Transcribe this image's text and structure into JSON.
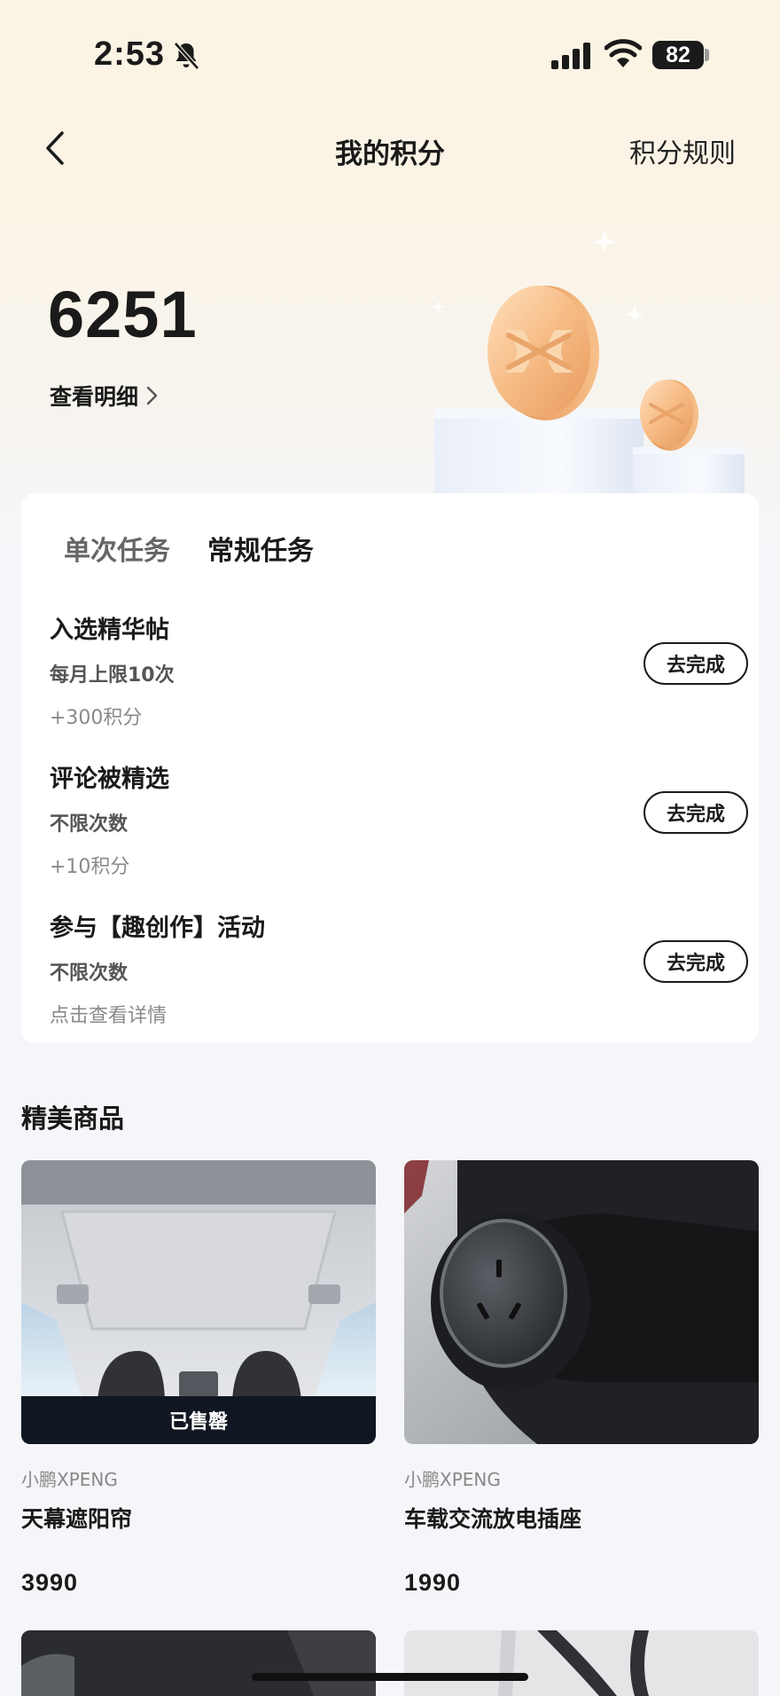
{
  "status_bar": {
    "time": "2:53",
    "battery": "82"
  },
  "nav": {
    "title": "我的积分",
    "rules_label": "积分规则"
  },
  "points": {
    "value": "6251",
    "detail_label": "查看明细"
  },
  "tasks": {
    "tabs": [
      {
        "label": "单次任务",
        "active": false
      },
      {
        "label": "常规任务",
        "active": true
      }
    ],
    "items": [
      {
        "title": "入选精华帖",
        "limit": "每月上限10次",
        "reward": "+300积分",
        "button": "去完成"
      },
      {
        "title": "评论被精选",
        "limit": "不限次数",
        "reward": "+10积分",
        "button": "去完成"
      },
      {
        "title": "参与【趣创作】活动",
        "limit": "不限次数",
        "reward": "点击查看详情",
        "button": "去完成"
      }
    ]
  },
  "products_section": {
    "title": "精美商品",
    "items": [
      {
        "brand": "小鹏XPENG",
        "name": "天幕遮阳帘",
        "price": "3990",
        "badge": "已售罄"
      },
      {
        "brand": "小鹏XPENG",
        "name": "车载交流放电插座",
        "price": "1990",
        "badge": ""
      }
    ]
  },
  "colors": {
    "accent_dark": "#1a1a1a",
    "hero_bg": "#fbf3e3",
    "coin": "#f3b982",
    "sold_out_bg": "#101722"
  }
}
